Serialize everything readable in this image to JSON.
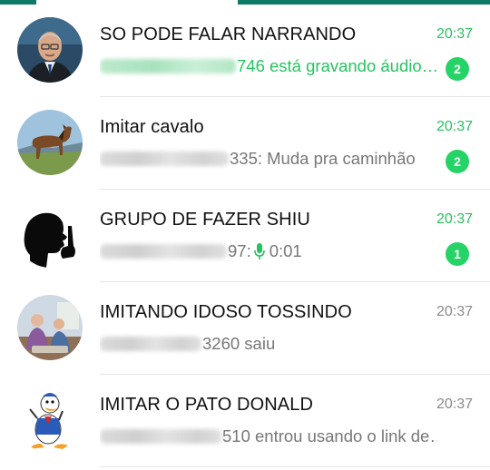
{
  "chats": [
    {
      "title": "SO PODE FALAR NARRANDO",
      "time": "20:37",
      "preview_text": "746 está gravando áudio…",
      "unread": "2",
      "avatar_icon": "man-tv-presenter-photo"
    },
    {
      "title": "Imitar cavalo",
      "time": "20:37",
      "preview_text": "335: Muda pra caminhão",
      "unread": "2",
      "avatar_icon": "horse-photo"
    },
    {
      "title": "GRUPO DE FAZER SHIU",
      "time": "20:37",
      "preview_text": "97:",
      "preview_voice": "0:01",
      "unread": "1",
      "avatar_icon": "shush-silhouette"
    },
    {
      "title": "IMITANDO IDOSO TOSSINDO",
      "time": "20:37",
      "preview_text": "3260 saiu",
      "avatar_icon": "elderly-people-photo"
    },
    {
      "title": "IMITAR O PATO DONALD",
      "time": "20:37",
      "preview_text": "510 entrou usando o link de…",
      "avatar_icon": "donald-duck-cartoon"
    }
  ],
  "colors": {
    "accent_green": "#25d366",
    "header_teal": "#0d7a68",
    "muted_text": "#8a8a8a"
  }
}
